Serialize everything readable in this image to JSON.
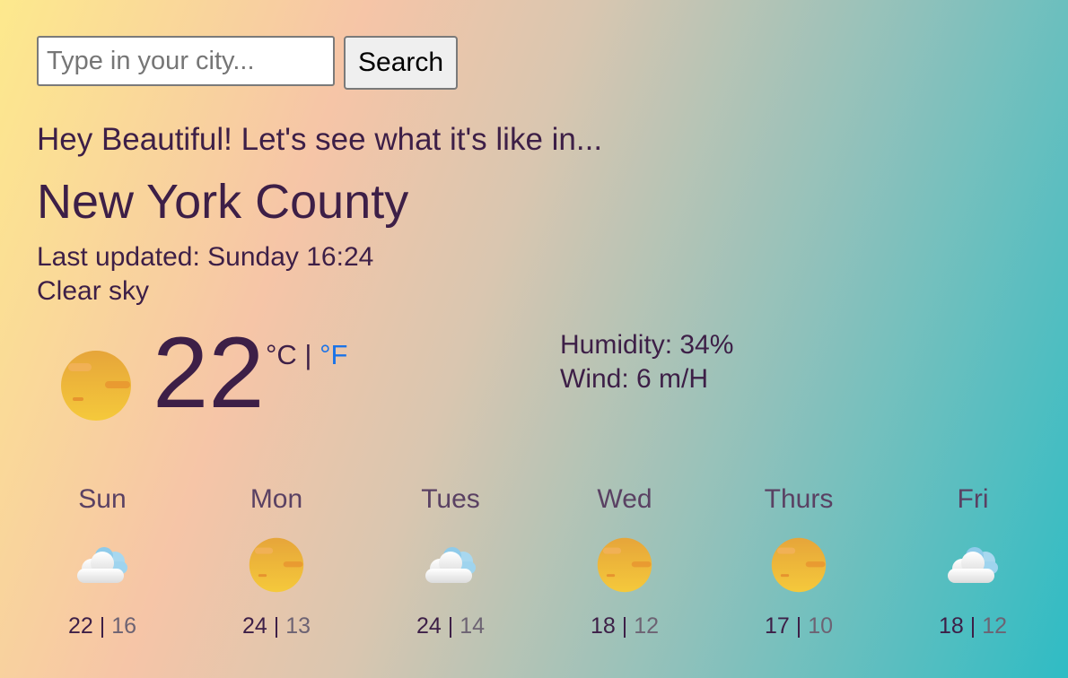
{
  "search": {
    "placeholder": "Type in your city...",
    "button_label": "Search"
  },
  "greeting": "Hey Beautiful! Let's see what it's like in...",
  "city": "New York County",
  "last_updated": "Last updated: Sunday 16:24",
  "description": "Clear sky",
  "current": {
    "temperature": "22",
    "icon": "sun-icon",
    "unit_celsius": "°C",
    "unit_separator": " | ",
    "unit_fahrenheit": "°F",
    "humidity": "Humidity: 34%",
    "wind": "Wind: 6 m/H"
  },
  "forecast": [
    {
      "day": "Sun",
      "icon": "cloud-icon",
      "max": "22",
      "min": "16"
    },
    {
      "day": "Mon",
      "icon": "sun-icon",
      "max": "24",
      "min": "13"
    },
    {
      "day": "Tues",
      "icon": "cloud-icon",
      "max": "24",
      "min": "14"
    },
    {
      "day": "Wed",
      "icon": "sun-icon",
      "max": "18",
      "min": "12"
    },
    {
      "day": "Thurs",
      "icon": "sun-icon",
      "max": "17",
      "min": "10"
    },
    {
      "day": "Fri",
      "icon": "cloud-icon",
      "max": "18",
      "min": "12"
    }
  ],
  "colors": {
    "text": "#3d1f47",
    "link": "#1a73e8",
    "sun": "#f0b93a",
    "cloud": "#a8d8ef"
  }
}
